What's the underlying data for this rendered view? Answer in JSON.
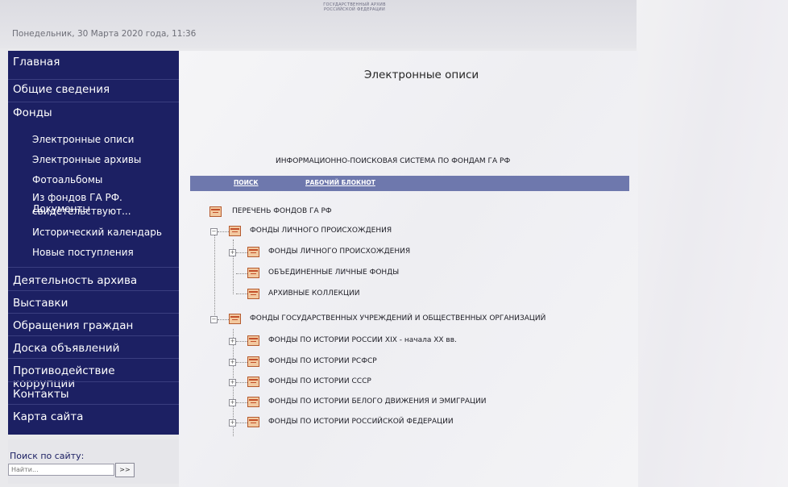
{
  "header": {
    "logo_line1": "ГОСУДАРСТВЕННЫЙ АРХИВ",
    "logo_line2": "РОССИЙСКОЙ ФЕДЕРАЦИИ",
    "date": "Понедельник, 30 Марта 2020 года, 11:36"
  },
  "sidebar": {
    "items": [
      {
        "label": "Главная"
      },
      {
        "label": "Общие сведения"
      },
      {
        "label": "Фонды"
      },
      {
        "label": "Электронные описи"
      },
      {
        "label": "Электронные архивы"
      },
      {
        "label": "Фотоальбомы"
      },
      {
        "label": "Из фондов ГА РФ. Документы"
      },
      {
        "label": "свидетельствуют..."
      },
      {
        "label": "Исторический календарь"
      },
      {
        "label": "Новые поступления"
      },
      {
        "label": "Деятельность архива"
      },
      {
        "label": "Выставки"
      },
      {
        "label": "Обращения граждан"
      },
      {
        "label": "Доска объявлений"
      },
      {
        "label": "Противодействие коррупции"
      },
      {
        "label": "Контакты"
      },
      {
        "label": "Карта сайта"
      }
    ]
  },
  "search": {
    "label": "Поиск по сайту:",
    "placeholder": "Найти...",
    "button_label": ">>"
  },
  "main": {
    "title": "Электронные описи",
    "system_title": "ИНФОРМАЦИОННО-ПОИСКОВАЯ СИСТЕМА ПО ФОНДАМ ГА РФ",
    "toolbar": {
      "search_link": "ПОИСК",
      "notebook_link": "РАБОЧИЙ БЛОКНОТ"
    },
    "tree": {
      "root": "ПЕРЕЧЕНЬ ФОНДОВ ГА РФ",
      "personal": "ФОНДЫ ЛИЧНОГО ПРОИСХОЖДЕНИЯ",
      "personal_children": [
        "ФОНДЫ ЛИЧНОГО ПРОИСХОЖДЕНИЯ",
        "ОБЪЕДИНЕННЫЕ ЛИЧНЫЕ ФОНДЫ",
        "АРХИВНЫЕ КОЛЛЕКЦИИ"
      ],
      "state": "ФОНДЫ ГОСУДАРСТВЕННЫХ УЧРЕЖДЕНИЙ И ОБЩЕСТВЕННЫХ ОРГАНИЗАЦИЙ",
      "state_children": [
        "ФОНДЫ ПО ИСТОРИИ РОССИИ XIX - начала XX вв.",
        "ФОНДЫ ПО ИСТОРИИ РСФСР",
        "ФОНДЫ ПО ИСТОРИИ СССР",
        "ФОНДЫ ПО ИСТОРИИ БЕЛОГО ДВИЖЕНИЯ И ЭМИГРАЦИИ",
        "ФОНДЫ ПО ИСТОРИИ РОССИЙСКОЙ ФЕДЕРАЦИИ"
      ]
    }
  }
}
